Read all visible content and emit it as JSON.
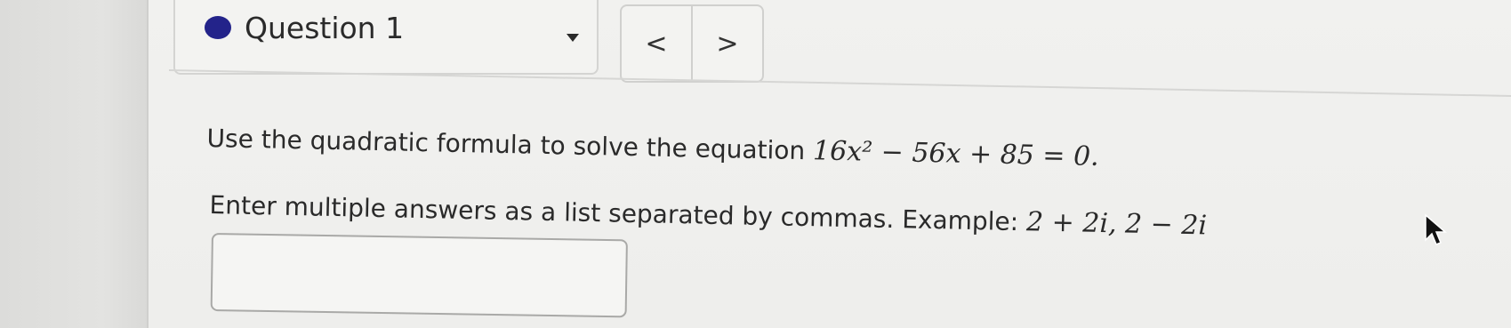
{
  "question_selector": {
    "label": "Question 1",
    "status_color": "#23238a",
    "dropdown_icon": "caret-down-icon"
  },
  "navigation": {
    "prev_label": "<",
    "next_label": ">"
  },
  "question": {
    "line1_text": "Use the quadratic formula to solve the equation ",
    "equation": "16x² − 56x + 85 = 0.",
    "line2_text": "Enter multiple answers as a list separated by commas. Example: ",
    "example": "2 + 2i, 2 − 2i"
  },
  "answer_input": {
    "value": "",
    "placeholder": ""
  },
  "cursor": {
    "icon": "mouse-pointer-icon"
  }
}
